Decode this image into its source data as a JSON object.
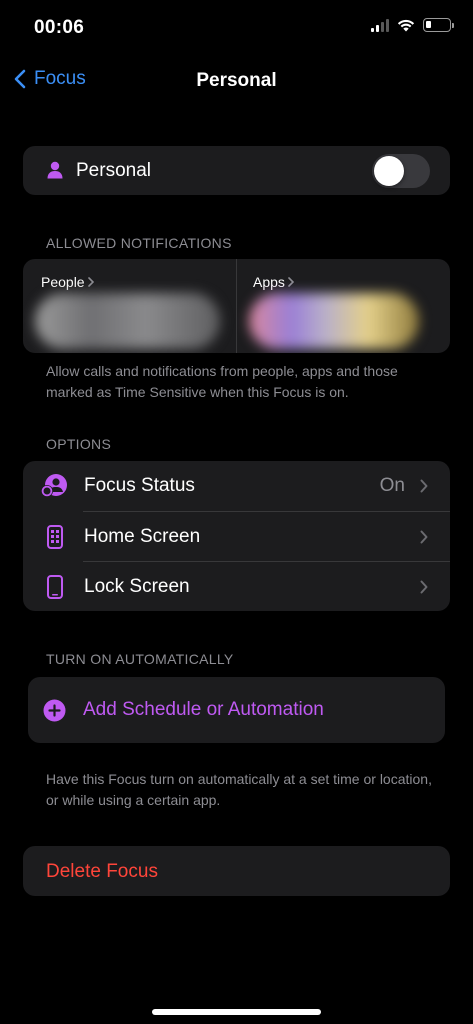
{
  "status_bar": {
    "time": "00:06"
  },
  "nav": {
    "back_label": "Focus",
    "title": "Personal"
  },
  "focus_card": {
    "label": "Personal",
    "toggle_on": false
  },
  "allowed_notifications": {
    "header": "ALLOWED NOTIFICATIONS",
    "people_label": "People",
    "apps_label": "Apps",
    "footnote": "Allow calls and notifications from people, apps and those marked as Time Sensitive when this Focus is on."
  },
  "options": {
    "header": "OPTIONS",
    "items": [
      {
        "label": "Focus Status",
        "value": "On",
        "icon": "focus-status-icon"
      },
      {
        "label": "Home Screen",
        "value": "",
        "icon": "home-screen-icon"
      },
      {
        "label": "Lock Screen",
        "value": "",
        "icon": "lock-screen-icon"
      }
    ]
  },
  "automation": {
    "header": "TURN ON AUTOMATICALLY",
    "add_label": "Add Schedule or Automation",
    "footnote": "Have this Focus turn on automatically at a set time or location, or while using a certain app."
  },
  "delete_label": "Delete Focus",
  "colors": {
    "accent_purple": "#bf5af2",
    "link_blue": "#3b8ff6",
    "destructive_red": "#ff453a"
  }
}
